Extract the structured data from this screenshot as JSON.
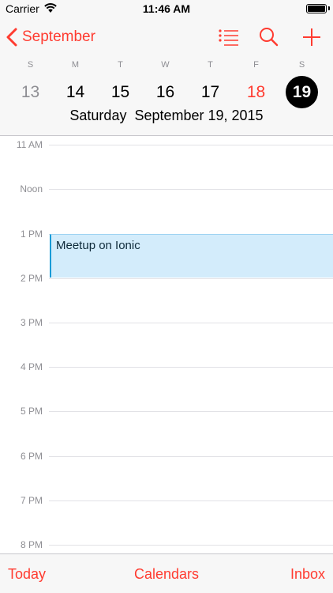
{
  "status_bar": {
    "carrier": "Carrier",
    "time": "11:46 AM"
  },
  "nav": {
    "back_label": "September",
    "icons": [
      "list-icon",
      "search-icon",
      "add-icon"
    ],
    "accent_color": "#ff3b30"
  },
  "week": {
    "days": [
      {
        "letter": "S",
        "date": "13"
      },
      {
        "letter": "M",
        "date": "14"
      },
      {
        "letter": "T",
        "date": "15"
      },
      {
        "letter": "W",
        "date": "16"
      },
      {
        "letter": "T",
        "date": "17"
      },
      {
        "letter": "F",
        "date": "18"
      },
      {
        "letter": "S",
        "date": "19"
      }
    ],
    "selected_weekday": "Saturday",
    "selected_date": "September 19, 2015"
  },
  "day_view": {
    "hours": [
      "11 AM",
      "Noon",
      "1 PM",
      "2 PM",
      "3 PM",
      "4 PM",
      "5 PM",
      "6 PM",
      "7 PM",
      "8 PM"
    ],
    "events": [
      {
        "title": "Meetup on Ionic",
        "color": "#d3ecfb",
        "accent": "#1a9bd7"
      }
    ]
  },
  "toolbar": {
    "today": "Today",
    "calendars": "Calendars",
    "inbox": "Inbox"
  }
}
